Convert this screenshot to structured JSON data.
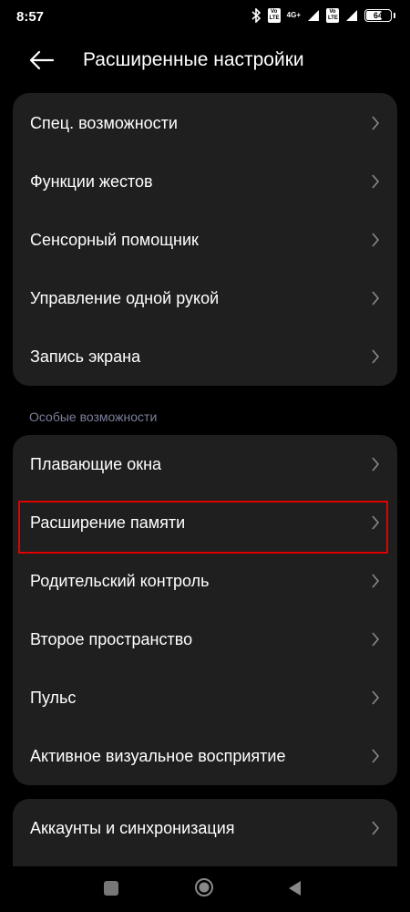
{
  "status_bar": {
    "time": "8:57",
    "sim1_badge": "Vo LTE",
    "network": "4G+",
    "sim2_badge": "Vo LTE",
    "battery": "64"
  },
  "header": {
    "title": "Расширенные настройки"
  },
  "group1": {
    "items": [
      {
        "label": "Спец. возможности"
      },
      {
        "label": "Функции жестов"
      },
      {
        "label": "Сенсорный помощник"
      },
      {
        "label": "Управление одной рукой"
      },
      {
        "label": "Запись экрана"
      }
    ]
  },
  "section2": {
    "title": "Особые возможности",
    "items": [
      {
        "label": "Плавающие окна"
      },
      {
        "label": "Расширение памяти"
      },
      {
        "label": "Родительский контроль"
      },
      {
        "label": "Второе пространство"
      },
      {
        "label": "Пульс"
      },
      {
        "label": "Активное визуальное восприятие"
      }
    ]
  },
  "group3": {
    "items": [
      {
        "label": "Аккаунты и синхронизация"
      }
    ]
  },
  "colors": {
    "background": "#000000",
    "card": "#1f1f1f",
    "highlight": "#e00000",
    "section_label": "#7a7f9a"
  }
}
